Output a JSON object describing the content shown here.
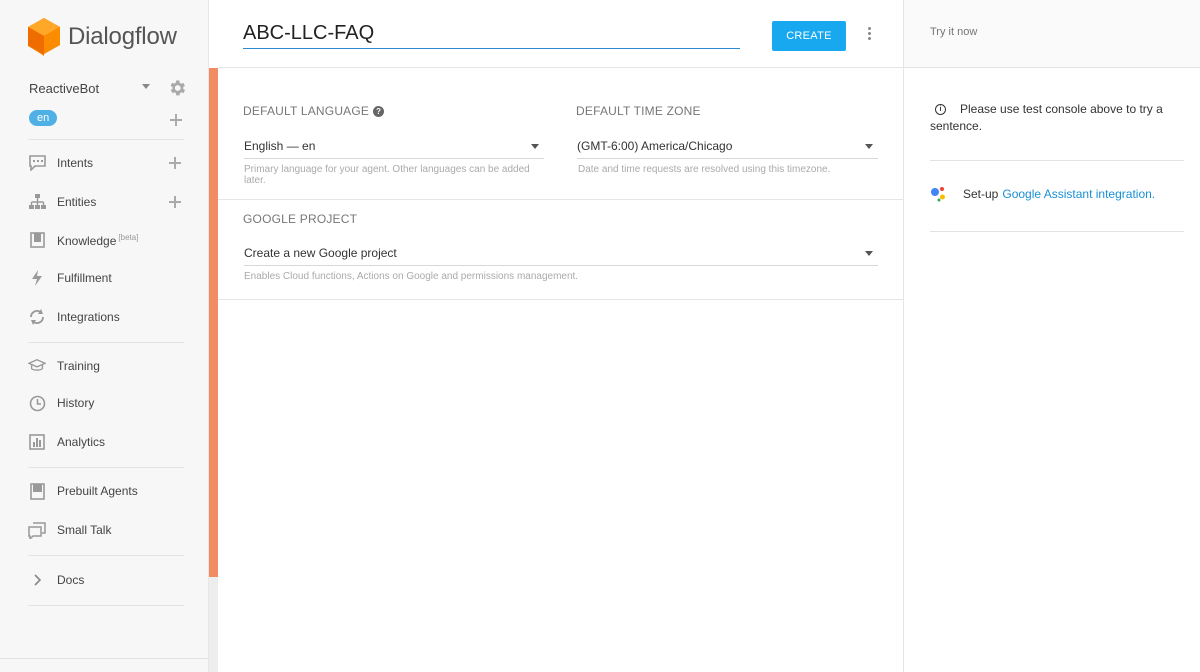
{
  "app": {
    "name": "Dialogflow"
  },
  "sidebar": {
    "agent_name": "ReactiveBot",
    "language_pill": "en",
    "items": [
      {
        "label": "Intents",
        "icon": "intents-icon"
      },
      {
        "label": "Entities",
        "icon": "entities-icon"
      },
      {
        "label": "Knowledge",
        "badge": "[beta]",
        "icon": "knowledge-icon"
      },
      {
        "label": "Fulfillment",
        "icon": "fulfillment-icon"
      },
      {
        "label": "Integrations",
        "icon": "integrations-icon"
      },
      {
        "label": "Training",
        "icon": "training-icon"
      },
      {
        "label": "History",
        "icon": "history-icon"
      },
      {
        "label": "Analytics",
        "icon": "analytics-icon"
      },
      {
        "label": "Prebuilt Agents",
        "icon": "prebuilt-agents-icon"
      },
      {
        "label": "Small Talk",
        "icon": "small-talk-icon"
      },
      {
        "label": "Docs",
        "icon": "chevron-right-icon"
      }
    ]
  },
  "header": {
    "agent_name_value": "ABC-LLC-FAQ",
    "create_label": "CREATE"
  },
  "settings": {
    "default_language": {
      "label": "DEFAULT LANGUAGE",
      "value": "English — en",
      "helper": "Primary language for your agent. Other languages can be added later."
    },
    "default_time_zone": {
      "label": "DEFAULT TIME ZONE",
      "value": "(GMT-6:00) America/Chicago",
      "helper": "Date and time requests are resolved using this timezone."
    },
    "google_project": {
      "label": "GOOGLE PROJECT",
      "value": "Create a new Google project",
      "helper": "Enables Cloud functions, Actions on Google and permissions management."
    }
  },
  "right_panel": {
    "try_placeholder": "Try it now",
    "info_text": "Please use test console above to try a sentence.",
    "ga_prefix": "Set-up",
    "ga_link": "Google Assistant integration."
  },
  "colors": {
    "accent": "#f38b62",
    "primary": "#18a8f0",
    "link": "#1a8fd6"
  }
}
